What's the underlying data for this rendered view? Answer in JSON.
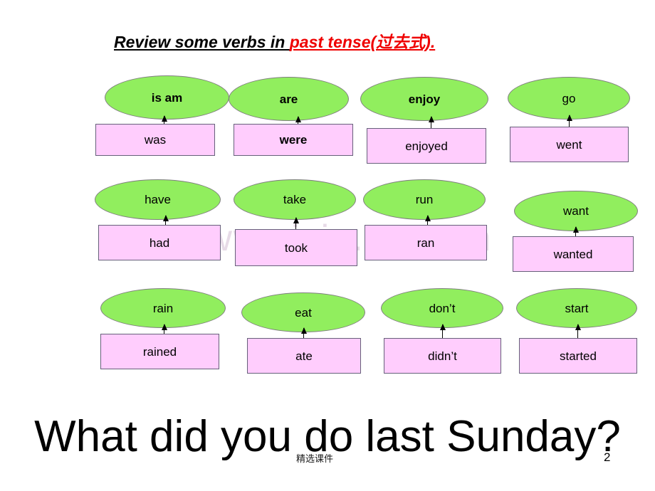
{
  "slide": {
    "title": {
      "part_black": "Review some verbs in ",
      "part_red": "past tense(过去式)."
    },
    "question": "What did you do last Sunday?",
    "footer_note": "精选课件",
    "page_number": "2",
    "watermark": "www.zixin.com.cn",
    "colors": {
      "oval_fill": "#91ee5e",
      "oval_border": "#7f7f7f",
      "box_fill": "#ffcdfd",
      "box_border": "#66607a",
      "title_accent": "#ef0000",
      "watermark": "#e7dbe7"
    }
  },
  "pairs": [
    {
      "present": "is   am",
      "past": "was",
      "present_bold": true,
      "past_bold": false
    },
    {
      "present": "are",
      "past": "were",
      "present_bold": true,
      "past_bold": true
    },
    {
      "present": "enjoy",
      "past": "enjoyed",
      "present_bold": true,
      "past_bold": false
    },
    {
      "present": "go",
      "past": "went",
      "present_bold": false,
      "past_bold": false
    },
    {
      "present": "have",
      "past": "had",
      "present_bold": false,
      "past_bold": false
    },
    {
      "present": "take",
      "past": "took",
      "present_bold": false,
      "past_bold": false
    },
    {
      "present": "run",
      "past": "ran",
      "present_bold": false,
      "past_bold": false
    },
    {
      "present": "want",
      "past": "wanted",
      "present_bold": false,
      "past_bold": false
    },
    {
      "present": "rain",
      "past": "rained",
      "present_bold": false,
      "past_bold": false
    },
    {
      "present": "eat",
      "past": "ate",
      "present_bold": false,
      "past_bold": false
    },
    {
      "present": "don’t",
      "past": "didn’t",
      "present_bold": false,
      "past_bold": false
    },
    {
      "present": "start",
      "past": "started",
      "present_bold": false,
      "past_bold": false
    }
  ]
}
